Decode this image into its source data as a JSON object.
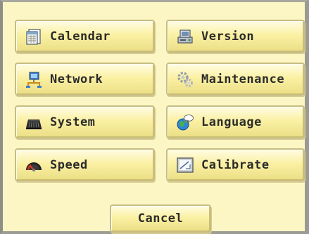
{
  "menu": {
    "buttons": [
      {
        "label": "Calendar",
        "icon": "calendar-icon"
      },
      {
        "label": "Version",
        "icon": "version-icon"
      },
      {
        "label": "Network",
        "icon": "network-icon"
      },
      {
        "label": "Maintenance",
        "icon": "maintenance-icon"
      },
      {
        "label": "System",
        "icon": "system-icon"
      },
      {
        "label": "Language",
        "icon": "language-icon"
      },
      {
        "label": "Speed",
        "icon": "speed-icon"
      },
      {
        "label": "Calibrate",
        "icon": "calibrate-icon"
      }
    ],
    "cancel_label": "Cancel"
  },
  "colors": {
    "panel_background": "#fbf6c4",
    "button_top": "#fffce4",
    "button_bottom": "#ebde86",
    "frame": "#9a9a92",
    "text": "#2b2b2b"
  }
}
